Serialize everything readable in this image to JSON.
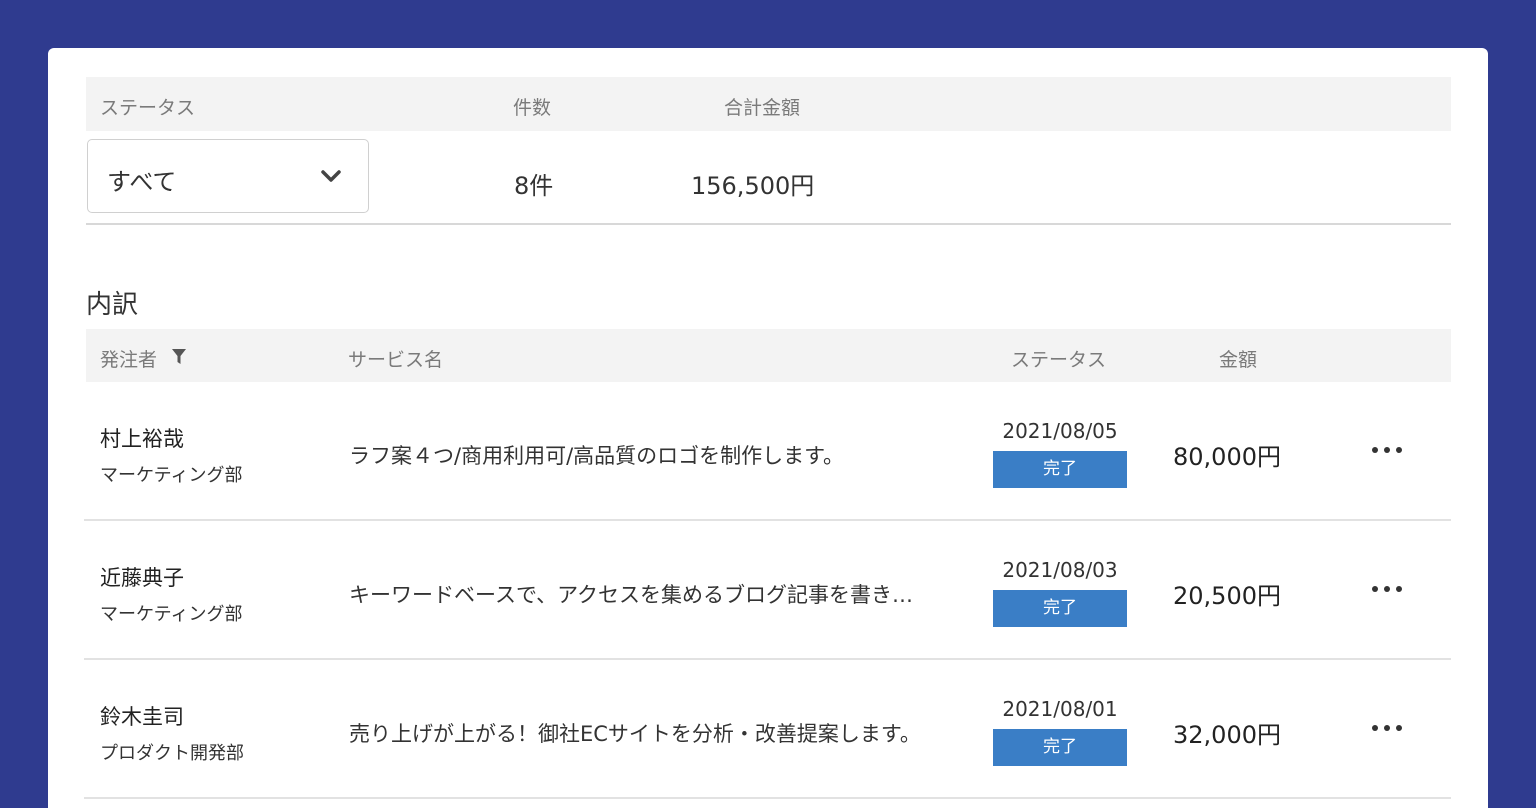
{
  "summary": {
    "status_label": "ステータス",
    "count_label": "件数",
    "total_label": "合計金額",
    "status_select": {
      "value": "すべて",
      "icon": "chevron-down-icon"
    },
    "count_value": "8件",
    "total_value": "156,500円"
  },
  "breakdown": {
    "title": "内訳",
    "headers": {
      "orderer": "発注者",
      "orderer_icon": "filter-icon",
      "service": "サービス名",
      "status": "ステータス",
      "amount": "金額"
    },
    "rows": [
      {
        "name": "村上裕哉",
        "dept": "マーケティング部",
        "service": "ラフ案４つ/商用利用可/高品質のロゴを制作します。",
        "date": "2021/08/05",
        "status": "完了",
        "amount": "80,000円"
      },
      {
        "name": "近藤典子",
        "dept": "マーケティング部",
        "service": "キーワードベースで、アクセスを集めるブログ記事を書き…",
        "date": "2021/08/03",
        "status": "完了",
        "amount": "20,500円"
      },
      {
        "name": "鈴木圭司",
        "dept": "プロダクト開発部",
        "service": "売り上げが上がる！御社ECサイトを分析・改善提案します。",
        "date": "2021/08/01",
        "status": "完了",
        "amount": "32,000円"
      }
    ]
  },
  "colors": {
    "background": "#2f3b8f",
    "header_bg": "#f3f3f3",
    "status_badge": "#3a7ec6"
  }
}
